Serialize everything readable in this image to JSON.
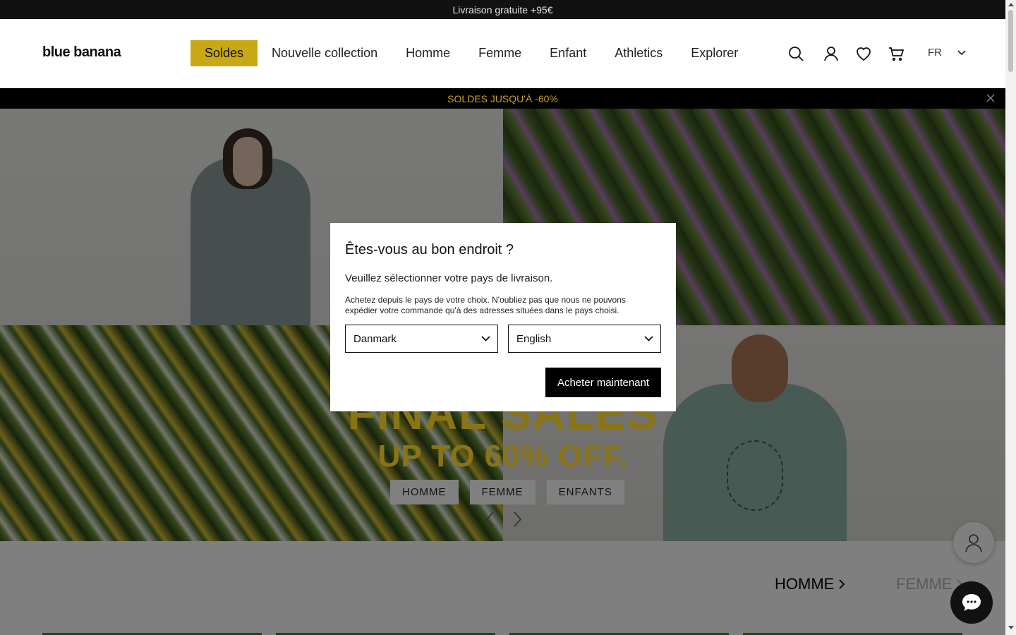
{
  "topbar": {
    "text": "Livraison gratuite +95€"
  },
  "header": {
    "logo": "blue banana",
    "nav": [
      {
        "label": "Soldes"
      },
      {
        "label": "Nouvelle collection"
      },
      {
        "label": "Homme"
      },
      {
        "label": "Femme"
      },
      {
        "label": "Enfant"
      },
      {
        "label": "Athletics"
      },
      {
        "label": "Explorer"
      }
    ],
    "icons": [
      "search-icon",
      "account-icon",
      "heart-icon",
      "cart-icon"
    ],
    "language": "FR"
  },
  "promo": {
    "text": "SOLDES JUSQU'À -60%"
  },
  "hero": {
    "title": "FINAL SALES",
    "subtitle": "UP TO 60% OFF.",
    "buttons": [
      {
        "label": "HOMME"
      },
      {
        "label": "FEMME"
      },
      {
        "label": "ENFANTS"
      }
    ]
  },
  "section": {
    "tabs": [
      {
        "label": "HOMME"
      },
      {
        "label": "FEMME"
      }
    ]
  },
  "modal": {
    "title": "Êtes-vous au bon endroit ?",
    "subtitle": "Veuillez sélectionner votre pays de livraison.",
    "note": "Achetez depuis le pays de votre choix. N'oubliez pas que nous ne pouvons expédier votre commande qu'à des adresses situées dans le pays choisi.",
    "country": "Danmark",
    "language": "English",
    "button": "Acheter maintenant"
  },
  "colors": {
    "sale_accent": "#c8a814",
    "promo_text": "#c8a22a",
    "hero_text": "#e7c62c"
  }
}
